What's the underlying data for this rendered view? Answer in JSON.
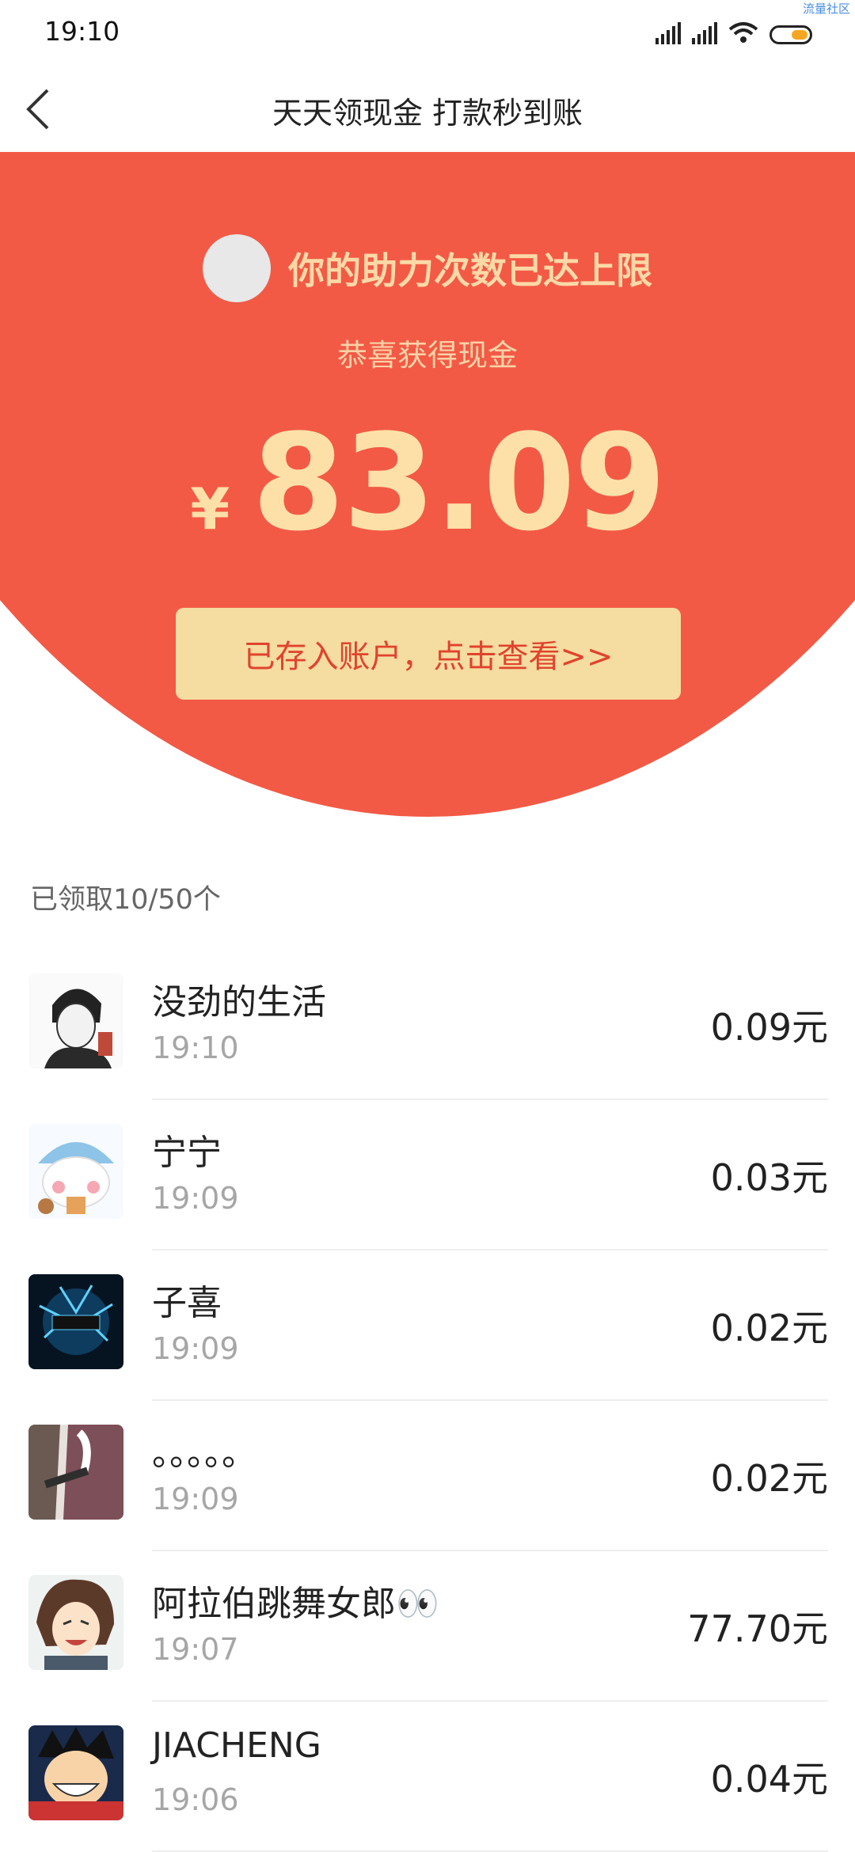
{
  "status_bar": {
    "time": "19:10",
    "watermark": "流量社区"
  },
  "nav": {
    "title": "天天领现金 打款秒到账"
  },
  "hero": {
    "title": "你的助力次数已达上限",
    "subtitle": "恭喜获得现金",
    "currency": "¥",
    "amount": "83.09",
    "button_label": "已存入账户，点击查看>>"
  },
  "list": {
    "count_label": "已领取10/50个",
    "items": [
      {
        "name": "没劲的生活",
        "time": "19:10",
        "amount": "0.09元"
      },
      {
        "name": "宁宁",
        "time": "19:09",
        "amount": "0.03元"
      },
      {
        "name": "子喜",
        "time": "19:09",
        "amount": "0.02元"
      },
      {
        "name": "。。。。。",
        "time": "19:09",
        "amount": "0.02元"
      },
      {
        "name": "阿拉伯跳舞女郎👀",
        "time": "19:07",
        "amount": "77.70元"
      },
      {
        "name": "JIACHENG",
        "time": "19:06",
        "amount": "0.04元"
      }
    ]
  },
  "colors": {
    "hero_red": "#f25a46",
    "button_gold": "#f5dca0",
    "accent_text": "#fde0a8"
  }
}
